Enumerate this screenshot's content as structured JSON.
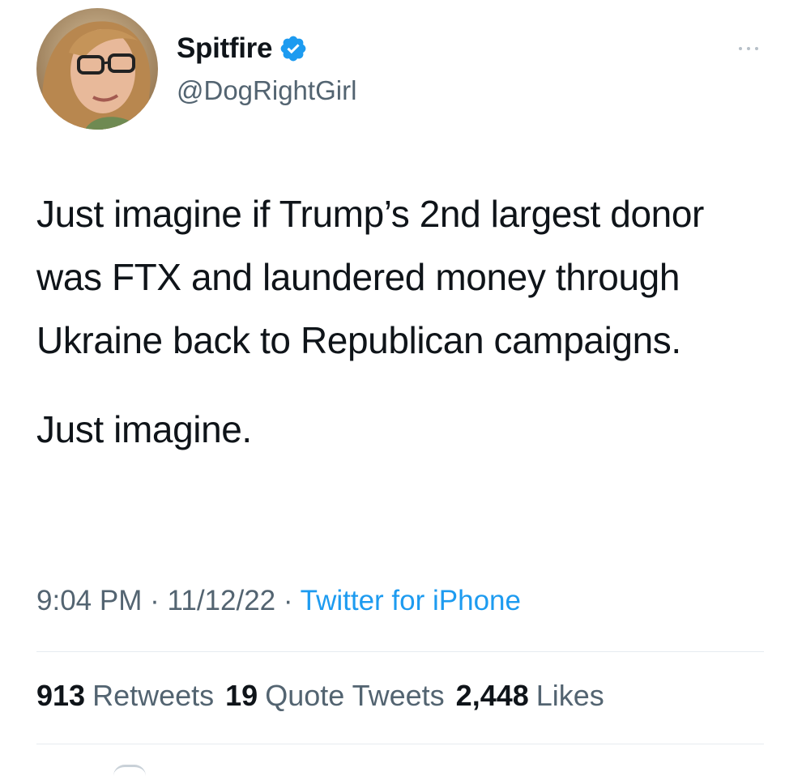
{
  "user": {
    "display_name": "Spitfire",
    "handle": "@DogRightGirl",
    "verified": true,
    "avatar_icon": "profile-photo",
    "verified_icon": "verified-badge-icon",
    "verified_color": "#1d9bf0"
  },
  "tweet": {
    "paragraphs": [
      "Just imagine if Trump’s 2nd largest donor was FTX and laundered money through Ukraine back to Republican campaigns.",
      "Just imagine."
    ],
    "time": "9:04 PM",
    "separator": "·",
    "date": "11/12/22",
    "source": "Twitter for iPhone"
  },
  "stats": {
    "retweets_count": "913",
    "retweets_label": "Retweets",
    "quotes_count": "19",
    "quotes_label": "Quote Tweets",
    "likes_count": "2,448",
    "likes_label": "Likes"
  },
  "colors": {
    "text": "#0f1419",
    "secondary": "#536471",
    "link": "#1d9bf0",
    "divider": "#e6ecf0"
  }
}
